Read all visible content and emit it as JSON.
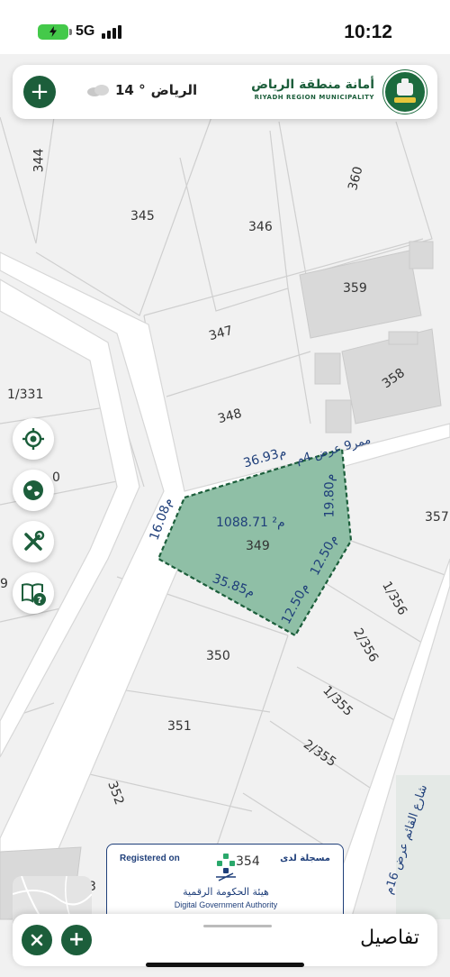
{
  "status_bar": {
    "time": "10:12",
    "network": "5G",
    "signal_bars": 4,
    "battery": "charging"
  },
  "header": {
    "weather_city": "الرياض",
    "weather_temp": "° 14",
    "weather_icon": "cloud-icon",
    "logo_arabic": "أمانة منطقة الرياض",
    "logo_english": "RIYADH REGION MUNICIPALITY",
    "add_icon": "plus-icon"
  },
  "tools": [
    {
      "name": "locate-tool-button",
      "icon": "crosshair-icon"
    },
    {
      "name": "globe-tool-button",
      "icon": "globe-icon"
    },
    {
      "name": "tools-button",
      "icon": "wrench-screwdriver-icon"
    },
    {
      "name": "guide-button",
      "icon": "book-help-icon"
    }
  ],
  "map": {
    "plots": [
      "344",
      "345",
      "346",
      "360",
      "359",
      "347",
      "358",
      "348",
      "1/331",
      "357",
      "350",
      "351",
      "352",
      "1/356",
      "2/356",
      "1/355",
      "2/355",
      "354",
      "3",
      "0",
      "9"
    ],
    "selected_parcel": {
      "number": "349",
      "area": "1088.71",
      "area_unit": "م²",
      "dimensions": [
        "36.93م",
        "19.80م",
        "12.50م",
        "12.50م",
        "35.85م",
        "16.08م"
      ],
      "fill_color": "#8fbfa6",
      "border_color": "#1c5e3b"
    },
    "streets": [
      "ممر9 عرض 4م",
      "شارع القائم عرض 16م"
    ]
  },
  "registration": {
    "english": "Registered on",
    "arabic": "مسجلة لدى",
    "authority_ar": "هيئة الحكومة الرقمية",
    "authority_en": "Digital Government Authority"
  },
  "bottom_sheet": {
    "title": "تفاصيل",
    "close_icon": "close-icon",
    "add_icon": "plus-icon"
  },
  "colors": {
    "brand_green": "#1c5e3b",
    "dimension_blue": "#1f3f7a"
  }
}
